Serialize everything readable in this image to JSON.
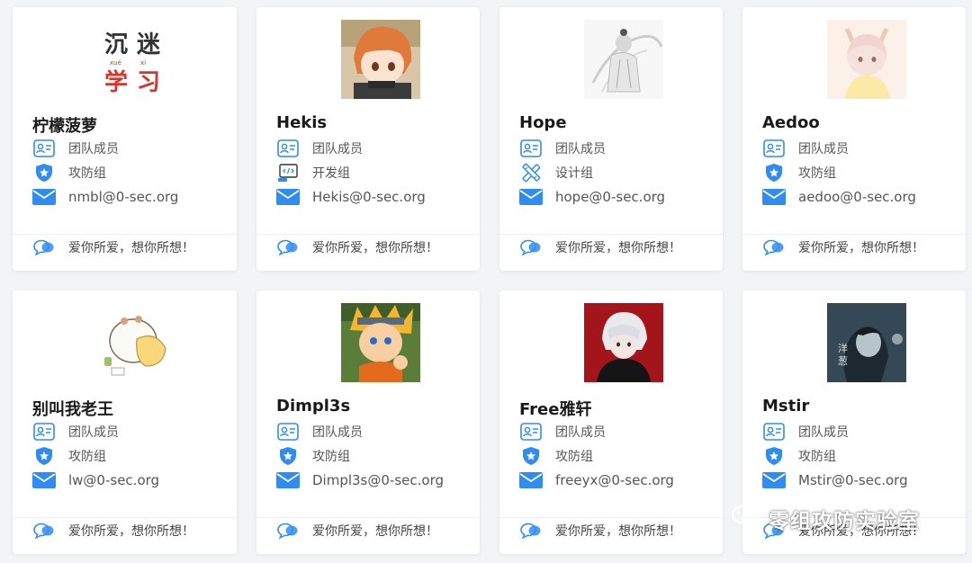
{
  "colors": {
    "accent": "#2f8cf2",
    "card_bg": "#ffffff",
    "page_bg": "#f3f4f6"
  },
  "cards": [
    {
      "name": "柠檬菠萝",
      "role": "团队成员",
      "group": "攻防组",
      "group_icon": "shield-icon",
      "email": "nmbl@0-sec.org",
      "motto": "爱你所爱，想你所想！",
      "avatar_text": [
        "沉",
        "迷",
        "学",
        "习"
      ],
      "avatar_pinyin": [
        "xué",
        "xí"
      ]
    },
    {
      "name": "Hekis",
      "role": "团队成员",
      "group": "开发组",
      "group_icon": "code-screen-icon",
      "email": "Hekis@0-sec.org",
      "motto": "爱你所爱，想你所想！"
    },
    {
      "name": "Hope",
      "role": "团队成员",
      "group": "设计组",
      "group_icon": "design-tools-icon",
      "email": "hope@0-sec.org",
      "motto": "爱你所爱，想你所想！"
    },
    {
      "name": "Aedoo",
      "role": "团队成员",
      "group": "攻防组",
      "group_icon": "shield-icon",
      "email": "aedoo@0-sec.org",
      "motto": "爱你所爱，想你所想！"
    },
    {
      "name": "别叫我老王",
      "role": "团队成员",
      "group": "攻防组",
      "group_icon": "shield-icon",
      "email": "lw@0-sec.org",
      "motto": "爱你所爱，想你所想！"
    },
    {
      "name": "Dimpl3s",
      "role": "团队成员",
      "group": "攻防组",
      "group_icon": "shield-icon",
      "email": "Dimpl3s@0-sec.org",
      "motto": "爱你所爱，想你所想！"
    },
    {
      "name": "Free雅轩",
      "role": "团队成员",
      "group": "攻防组",
      "group_icon": "shield-icon",
      "email": "freeyx@0-sec.org",
      "motto": "爱你所爱，想你所想！"
    },
    {
      "name": "Mstir",
      "role": "团队成员",
      "group": "攻防组",
      "group_icon": "shield-icon",
      "email": "Mstir@0-sec.org",
      "motto": "爱你所爱，想你所想！",
      "avatar_text": [
        "洋",
        "葱"
      ]
    }
  ],
  "watermark": {
    "text": "零组攻防实验室"
  }
}
